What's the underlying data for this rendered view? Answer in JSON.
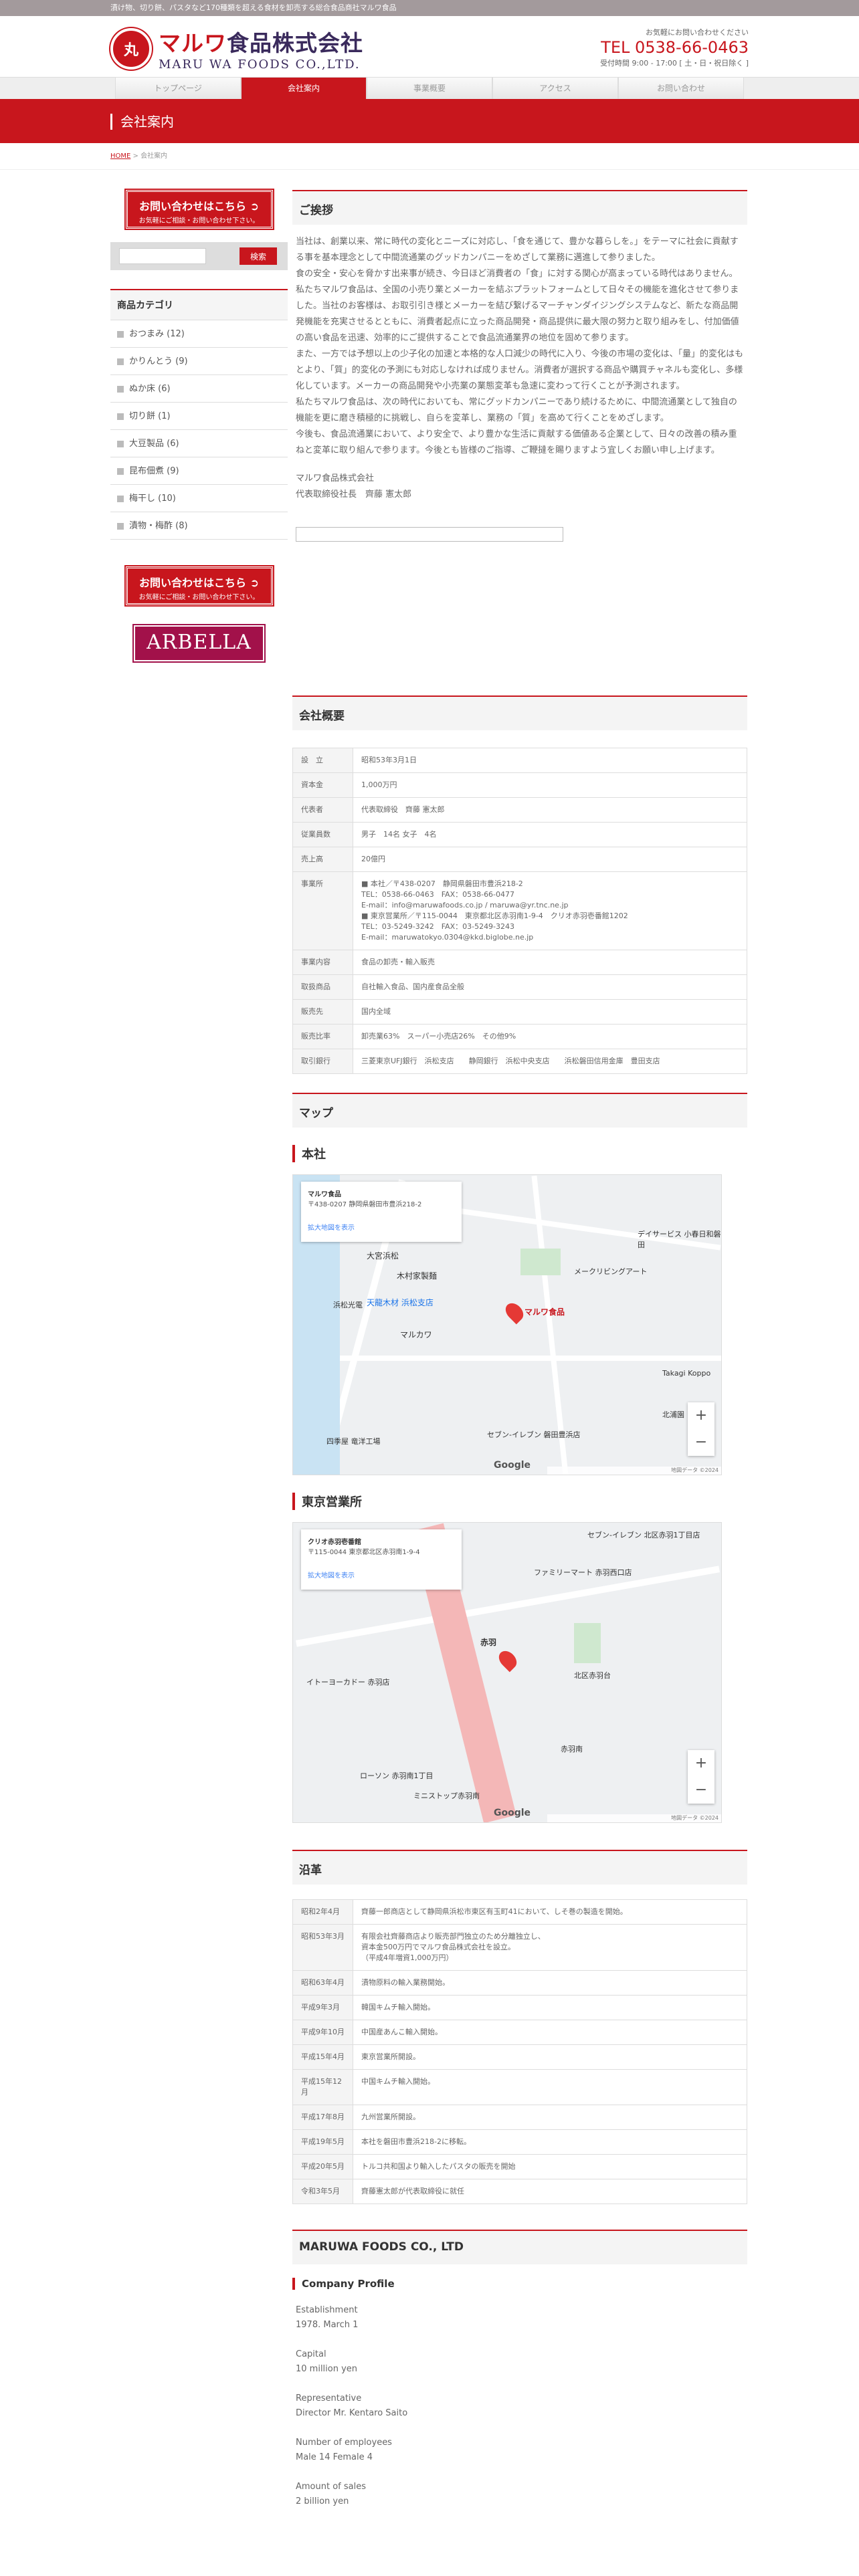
{
  "topbar": {
    "text": "漬け物、切り餅、パスタなど170種類を超える食材を卸売する総合食品商社マルワ食品"
  },
  "header": {
    "logo_mark": "丸",
    "logo_jp_brand": "マルワ",
    "logo_jp_rest": "食品株式会社",
    "logo_en": "MARU WA FOODS CO.,LTD.",
    "contact_line": "お気軽にお問い合わせください",
    "tel": "TEL 0538-66-0463",
    "hours": "受付時間 9:00 - 17:00 [ 土・日・祝日除く ]"
  },
  "nav": {
    "items": [
      "トップページ",
      "会社案内",
      "事業概要",
      "アクセス",
      "お問い合わせ"
    ],
    "active_index": 1
  },
  "page_title": "会社案内",
  "breadcrumb": {
    "home": "HOME",
    "sep": " > ",
    "current": "会社案内"
  },
  "sidebar": {
    "cta_title": "お問い合わせはこちら ➲",
    "cta_sub": "お気軽にご相談・お問い合わせ下さい。",
    "search_placeholder": "",
    "search_button": "検索",
    "category_title": "商品カテゴリ",
    "categories": [
      "おつまみ (12)",
      "かりんとう (9)",
      "ぬか床 (6)",
      "切り餅 (1)",
      "大豆製品 (6)",
      "昆布佃煮 (9)",
      "梅干し (10)",
      "漬物・梅酢 (8)"
    ],
    "arbella": "ARBELLA"
  },
  "greeting": {
    "heading": "ご挨拶",
    "paragraphs": [
      "当社は、創業以来、常に時代の変化とニーズに対応し、「食を通じて、豊かな暮らしを。」をテーマに社会に貢献する事を基本理念として中間流通業のグッドカンパニーをめざして業務に邁進して参りました。",
      "食の安全・安心を脅かす出来事が続き、今日ほど消費者の「食」に対する関心が高まっている時代はありません。私たちマルワ食品は、全国の小売り業とメーカーを結ぶプラットフォームとして日々その機能を進化させて参りました。当社のお客様は、お取引引き様とメーカーを結び繋げるマーチャンダイジングシステムなど、新たな商品開発機能を充実させるとともに、消費者起点に立った商品開発・商品提供に最大限の努力と取り組みをし、付加価値の高い食品を迅速、効率的にご提供することで食品流通業界の地位を固めて参ります。",
      "また、一方では予想以上の少子化の加速と本格的な人口減少の時代に入り、今後の市場の変化は、「量」的変化はもとより、「質」的変化の予測にも対応しなければ成りません。消費者が選択する商品や購買チャネルも変化し、多様化しています。メーカーの商品開発や小売業の業態変革も急速に変わって行くことが予測されます。",
      "私たちマルワ食品は、次の時代においても、常にグッドカンパニーであり続けるために、中間流通業として独自の機能を更に磨き積極的に挑戦し、自らを変革し、業務の「質」を高めて行くことをめざします。",
      "今後も、食品流通業において、より安全で、より豊かな生活に貢献する価値ある企業として、日々の改善の積み重ねと変革に取り組んで参ります。今後とも皆様のご指導、ご鞭撻を賜りますよう宜しくお願い申し上げます。"
    ],
    "company": "マルワ食品株式会社",
    "signature": "代表取締役社長　齊藤 憲太郎"
  },
  "overview": {
    "heading": "会社概要",
    "rows": [
      {
        "k": "設　立",
        "v": [
          "昭和53年3月1日"
        ]
      },
      {
        "k": "資本金",
        "v": [
          "1,000万円"
        ]
      },
      {
        "k": "代表者",
        "v": [
          "代表取締役　齊藤 憲太郎"
        ]
      },
      {
        "k": "従業員数",
        "v": [
          "男子　14名 女子　4名"
        ]
      },
      {
        "k": "売上高",
        "v": [
          "20億円"
        ]
      },
      {
        "k": "事業所",
        "v": [
          "■ 本社／〒438-0207　静岡県磐田市豊浜218-2",
          "TEL：0538-66-0463　FAX：0538-66-0477",
          "E-mail：info@maruwafoods.co.jp / maruwa@yr.tnc.ne.jp",
          "■ 東京営業所／〒115-0044　東京都北区赤羽南1-9-4　クリオ赤羽壱番館1202",
          "TEL：03-5249-3242　FAX：03-5249-3243",
          "E-mail：maruwatokyo.0304@kkd.biglobe.ne.jp"
        ]
      },
      {
        "k": "事業内容",
        "v": [
          "食品の卸売・輸入販売"
        ]
      },
      {
        "k": "取扱商品",
        "v": [
          "自社輸入食品、国内産食品全般"
        ]
      },
      {
        "k": "販売先",
        "v": [
          "国内全域"
        ]
      },
      {
        "k": "販売比率",
        "v": [
          "卸売業63%　スーパー小売店26%　その他9%"
        ]
      },
      {
        "k": "取引銀行",
        "v": [
          "三菱東京UFJ銀行　浜松支店　　静岡銀行　浜松中央支店　　浜松磐田信用金庫　豊田支店"
        ]
      }
    ]
  },
  "access": {
    "heading": "マップ",
    "hq": {
      "title": "本社",
      "card_name": "マルワ食品",
      "card_addr": "〒438-0207 静岡県磐田市豊浜218-2",
      "card_link": "拡大地図を表示",
      "pin_label": "マルワ食品",
      "labels": [
        "大宮浜松",
        "木村家製麺",
        "天龍木材 浜松支店",
        "マルカワ",
        "デイサービス 小春日和磐田",
        "メークリビングアート",
        "Takagi Koppo",
        "北浦園",
        "セブン-イレブン 磐田豊浜店",
        "四季屋 竜洋工場",
        "浜松光電"
      ],
      "footer": "地図データ ©2024"
    },
    "tokyo": {
      "title": "東京営業所",
      "card_name": "クリオ赤羽壱番館",
      "card_addr": "〒115-0044 東京都北区赤羽南1-9-4",
      "card_link": "拡大地図を表示",
      "labels": [
        "赤羽",
        "ファミリーマート 赤羽西口店",
        "セブン-イレブン 北区赤羽1丁目店",
        "イトーヨーカドー 赤羽店",
        "ローソン 赤羽南1丁目",
        "ミニストップ赤羽南",
        "北区赤羽台",
        "赤羽南"
      ],
      "footer": "地図データ ©2024"
    },
    "google": "Google"
  },
  "history": {
    "heading": "沿革",
    "rows": [
      {
        "k": "昭和2年4月",
        "v": [
          "齊藤一郎商店として静岡県浜松市東区有玉町41において、しそ巻の製造を開始。"
        ]
      },
      {
        "k": "昭和53年3月",
        "v": [
          "有限会社齊藤商店より販売部門独立のため分離独立し、",
          "資本金500万円でマルワ食品株式会社を設立。",
          "（平成4年増資1,000万円）"
        ]
      },
      {
        "k": "昭和63年4月",
        "v": [
          "漬物原料の輸入業務開始。"
        ]
      },
      {
        "k": "平成9年3月",
        "v": [
          "韓国キムチ輸入開始。"
        ]
      },
      {
        "k": "平成9年10月",
        "v": [
          "中国産あんこ輸入開始。"
        ]
      },
      {
        "k": "平成15年4月",
        "v": [
          "東京営業所開設。"
        ]
      },
      {
        "k": "平成15年12月",
        "v": [
          "中国キムチ輸入開始。"
        ]
      },
      {
        "k": "平成17年8月",
        "v": [
          "九州営業所開設。"
        ]
      },
      {
        "k": "平成19年5月",
        "v": [
          "本社を磐田市豊浜218-2に移転。"
        ]
      },
      {
        "k": "平成20年5月",
        "v": [
          "トルコ共和国より輸入したパスタの販売を開始"
        ]
      },
      {
        "k": "令和3年5月",
        "v": [
          "齊藤憲太郎が代表取締役に就任"
        ]
      }
    ]
  },
  "english": {
    "heading": "MARUWA FOODS CO., LTD",
    "subheading": "Company Profile",
    "items": [
      {
        "k": "Establishment",
        "v": "1978. March 1"
      },
      {
        "k": "Capital",
        "v": "10 million yen"
      },
      {
        "k": "Representative",
        "v": "Director Mr. Kentaro Saito"
      },
      {
        "k": "Number of employees",
        "v": "Male 14 Female 4"
      },
      {
        "k": "Amount of sales",
        "v": "2 billion yen"
      }
    ]
  },
  "colors": {
    "accent": "#c8161d",
    "brand_navy": "#3a2a5c",
    "arbella": "#a2114a"
  }
}
